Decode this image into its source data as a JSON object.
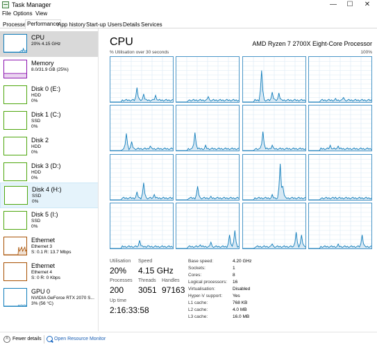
{
  "window": {
    "title": "Task Manager",
    "minimize": "—",
    "maximize": "☐",
    "close": "✕"
  },
  "menu": [
    "File",
    "Options",
    "View"
  ],
  "tabs": [
    {
      "label": "Processes"
    },
    {
      "label": "Performance",
      "active": true
    },
    {
      "label": "App history"
    },
    {
      "label": "Start-up"
    },
    {
      "label": "Users"
    },
    {
      "label": "Details"
    },
    {
      "label": "Services"
    }
  ],
  "sidebar": [
    {
      "name": "CPU",
      "line1": "20% 4.15 GHz",
      "line2": "",
      "color": "#117dbb",
      "kind": "cpu",
      "selected": true
    },
    {
      "name": "Memory",
      "line1": "8.0/31.9 GB (25%)",
      "line2": "",
      "color": "#8b12ae",
      "kind": "memory"
    },
    {
      "name": "Disk 0 (E:)",
      "line1": "HDD",
      "line2": "0%",
      "color": "#4da60c",
      "kind": "disk"
    },
    {
      "name": "Disk 1 (C:)",
      "line1": "SSD",
      "line2": "0%",
      "color": "#4da60c",
      "kind": "disk"
    },
    {
      "name": "Disk 2",
      "line1": "HDD",
      "line2": "0%",
      "color": "#4da60c",
      "kind": "disk"
    },
    {
      "name": "Disk 3 (D:)",
      "line1": "HDD",
      "line2": "0%",
      "color": "#4da60c",
      "kind": "disk"
    },
    {
      "name": "Disk 4 (H:)",
      "line1": "SSD",
      "line2": "0%",
      "color": "#4da60c",
      "kind": "disk",
      "hover": true
    },
    {
      "name": "Disk 5 (I:)",
      "line1": "SSD",
      "line2": "0%",
      "color": "#4da60c",
      "kind": "disk"
    },
    {
      "name": "Ethernet",
      "line1": "Ethernet 3",
      "line2": "S: 0.1  R: 13.7 Mbps",
      "color": "#a74f01",
      "kind": "ethernet"
    },
    {
      "name": "Ethernet",
      "line1": "Ethernet 4",
      "line2": "S: 0  R: 0 Kbps",
      "color": "#a74f01",
      "kind": "ethernet-idle"
    },
    {
      "name": "GPU 0",
      "line1": "NVIDIA GeForce RTX 2070 S...",
      "line2": "3% (56 °C)",
      "color": "#117dbb",
      "kind": "gpu"
    }
  ],
  "cpu": {
    "title": "CPU",
    "model": "AMD Ryzen 7 2700X Eight-Core Processor",
    "util_caption": "% Utilisation over 30 seconds",
    "util_max": "100%",
    "stats": {
      "utilisation_label": "Utilisation",
      "utilisation": "20%",
      "speed_label": "Speed",
      "speed": "4.15 GHz",
      "processes_label": "Processes",
      "processes": "200",
      "threads_label": "Threads",
      "threads": "3051",
      "handles_label": "Handles",
      "handles": "97163",
      "uptime_label": "Up time",
      "uptime": "2:16:33:58"
    },
    "info": [
      {
        "label": "Base speed:",
        "value": "4.20 GHz"
      },
      {
        "label": "Sockets:",
        "value": "1"
      },
      {
        "label": "Cores:",
        "value": "8"
      },
      {
        "label": "Logical processors:",
        "value": "16"
      },
      {
        "label": "Virtualisation:",
        "value": "Disabled"
      },
      {
        "label": "Hyper-V support:",
        "value": "Yes"
      },
      {
        "label": "L1 cache:",
        "value": "768 KB"
      },
      {
        "label": "L2 cache:",
        "value": "4.0 MB"
      },
      {
        "label": "L3 cache:",
        "value": "16.0 MB"
      }
    ],
    "graph_colors": {
      "line": "#117dbb",
      "fill": "#d6e8f4",
      "grid": "#d9eaf4",
      "border": "#4a96c7"
    },
    "core_peaks": [
      [
        [
          20,
          32
        ],
        [
          25,
          18
        ],
        [
          34,
          15
        ]
      ],
      [
        [
          24,
          12
        ]
      ],
      [
        [
          14,
          70
        ],
        [
          22,
          22
        ],
        [
          27,
          20
        ]
      ],
      [
        [
          20,
          8
        ],
        [
          26,
          10
        ]
      ],
      [
        [
          12,
          38
        ],
        [
          16,
          20
        ],
        [
          30,
          10
        ]
      ],
      [
        [
          14,
          40
        ],
        [
          22,
          12
        ]
      ],
      [
        [
          15,
          42
        ],
        [
          22,
          12
        ]
      ],
      [
        [
          16,
          12
        ],
        [
          22,
          10
        ]
      ],
      [
        [
          20,
          18
        ],
        [
          25,
          38
        ],
        [
          33,
          12
        ]
      ],
      [
        [
          16,
          30
        ],
        [
          26,
          8
        ]
      ],
      [
        [
          22,
          12
        ],
        [
          28,
          80
        ],
        [
          30,
          30
        ]
      ],
      [
        [
          20,
          6
        ]
      ],
      [
        [
          22,
          18
        ],
        [
          28,
          6
        ]
      ],
      [
        [
          18,
          8
        ],
        [
          26,
          14
        ],
        [
          40,
          30
        ],
        [
          44,
          40
        ]
      ],
      [
        [
          22,
          10
        ],
        [
          40,
          36
        ],
        [
          44,
          30
        ]
      ],
      [
        [
          22,
          10
        ],
        [
          40,
          30
        ]
      ]
    ]
  },
  "footer": {
    "fewer": "Fewer details",
    "monitor": "Open Resource Monitor"
  }
}
